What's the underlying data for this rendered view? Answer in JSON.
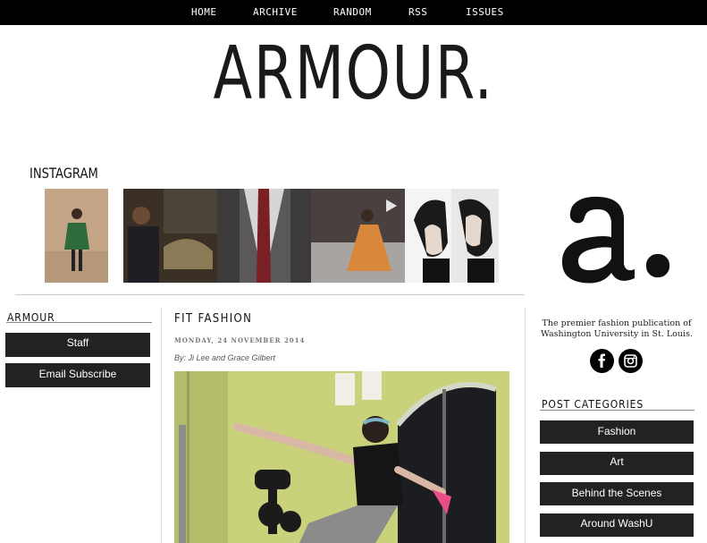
{
  "nav": {
    "items": [
      {
        "label": "HOME"
      },
      {
        "label": "ARCHIVE"
      },
      {
        "label": "RANDOM"
      },
      {
        "label": "RSS"
      },
      {
        "label": "ISSUES"
      }
    ]
  },
  "masthead": {
    "title": "ARMOUR."
  },
  "instagram": {
    "title": "INSTAGRAM"
  },
  "logo": {
    "text": "a."
  },
  "left_sidebar": {
    "heading": "ARMOUR",
    "buttons": [
      {
        "label": "Staff"
      },
      {
        "label": "Email Subscribe"
      }
    ]
  },
  "post": {
    "title": "FIT FASHION",
    "date": "MONDAY, 24 NOVEMBER 2014",
    "byline": "By: Ji Lee and Grace Gilbert"
  },
  "right_sidebar": {
    "tagline": "The premier fashion publication of Washington University in St. Louis.",
    "social_icons": [
      "facebook-icon",
      "instagram-icon"
    ],
    "categories_heading": "POST CATEGORIES",
    "categories": [
      {
        "label": "Fashion"
      },
      {
        "label": "Art"
      },
      {
        "label": "Behind the Scenes"
      },
      {
        "label": "Around WashU"
      }
    ]
  }
}
